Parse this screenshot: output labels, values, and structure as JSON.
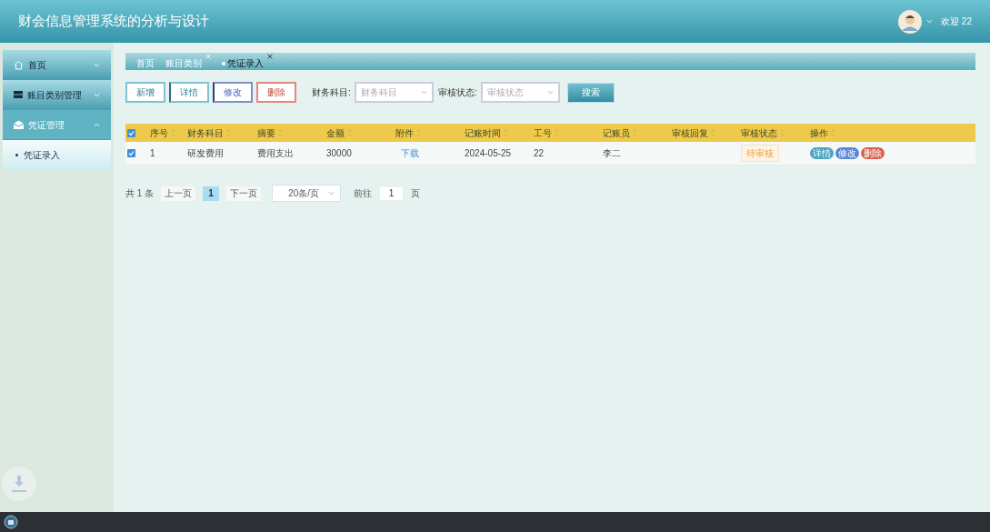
{
  "header": {
    "title": "财会信息管理系统的分析与设计",
    "user": "欢迎 22"
  },
  "menu": [
    {
      "label": "首页",
      "expanded": false,
      "selected": false
    },
    {
      "label": "账目类别管理",
      "expanded": false,
      "selected": false
    },
    {
      "label": "凭证管理",
      "expanded": true,
      "selected": true,
      "children": [
        {
          "label": "凭证录入",
          "selected": true
        }
      ]
    }
  ],
  "tabs": [
    {
      "label": "首页",
      "closable": false,
      "selected": false
    },
    {
      "label": "账目类别",
      "closable": true,
      "selected": false
    },
    {
      "label": "凭证录入",
      "closable": true,
      "selected": true
    }
  ],
  "toolbar": {
    "buttons": [
      {
        "label": "新增",
        "kind": "add"
      },
      {
        "label": "详情",
        "kind": "detail"
      },
      {
        "label": "修改",
        "kind": "edit"
      },
      {
        "label": "删除",
        "kind": "delete"
      }
    ],
    "filters": [
      {
        "label": "财务科目:",
        "placeholder": "财务科目"
      },
      {
        "label": "审核状态:",
        "placeholder": "审核状态"
      }
    ],
    "search": "搜索"
  },
  "table": {
    "all_checked": true,
    "columns": [
      "序号",
      "财务科目",
      "摘要",
      "金额",
      "附件",
      "记账时间",
      "工号",
      "记账员",
      "审核回复",
      "审核状态",
      "操作"
    ],
    "rows": [
      {
        "checked": true,
        "index": "1",
        "subject": "研发费用",
        "summary": "费用支出",
        "amount": "30000",
        "attachment": "下载",
        "time": "2024-05-25",
        "staff_no": "22",
        "clerk": "李二",
        "status": "待审核",
        "actions": [
          {
            "label": "详情",
            "kind": "detail"
          },
          {
            "label": "修改",
            "kind": "edit"
          },
          {
            "label": "删除",
            "kind": "delete"
          }
        ]
      }
    ]
  },
  "pagination": {
    "total": "共 1 条",
    "prev": "上一页",
    "pages": [
      {
        "label": "1",
        "selected": true
      }
    ],
    "next": "下一页",
    "page_size": "20条/页",
    "goto": "前往",
    "goto_value": "1",
    "goto_suffix": "页"
  }
}
